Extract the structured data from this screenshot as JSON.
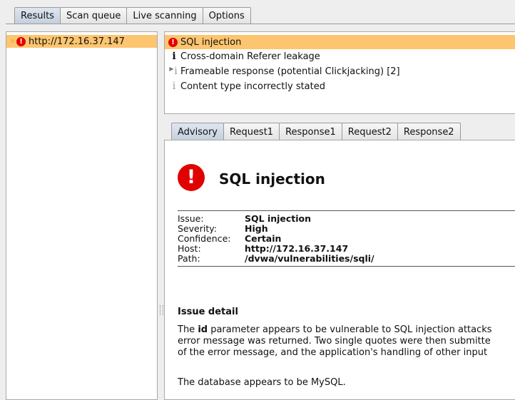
{
  "top_tabs": [
    "Results",
    "Scan queue",
    "Live scanning",
    "Options"
  ],
  "tree": {
    "host": "http://172.16.37.147"
  },
  "issues": [
    {
      "label": "SQL injection",
      "icon": "error-icon"
    },
    {
      "label": "Cross-domain Referer leakage",
      "icon": "info-icon"
    },
    {
      "label": "Frameable response (potential Clickjacking) [2]",
      "icon": "info-icon"
    },
    {
      "label": "Content type incorrectly stated",
      "icon": "info-icon"
    }
  ],
  "advisory_tabs": [
    "Advisory",
    "Request1",
    "Response1",
    "Request2",
    "Response2"
  ],
  "advisory": {
    "title": "SQL injection",
    "fields": [
      {
        "key": "Issue:",
        "value": "SQL injection"
      },
      {
        "key": "Severity:",
        "value": "High"
      },
      {
        "key": "Confidence:",
        "value": "Certain"
      },
      {
        "key": "Host:",
        "value": "http://172.16.37.147"
      },
      {
        "key": "Path:",
        "value": "/dvwa/vulnerabilities/sqli/"
      }
    ],
    "detail_heading": "Issue detail",
    "detail_prefix": "The ",
    "detail_param": "id",
    "detail_line1_rest": " parameter appears to be vulnerable to SQL injection attacks",
    "detail_line2": "error message was returned. Two single quotes were then submitte",
    "detail_line3": "of the error message, and the application's handling of other input",
    "detail_db": "The database appears to be MySQL."
  },
  "colors": {
    "selection": "#fdc570",
    "error": "#e10000"
  }
}
